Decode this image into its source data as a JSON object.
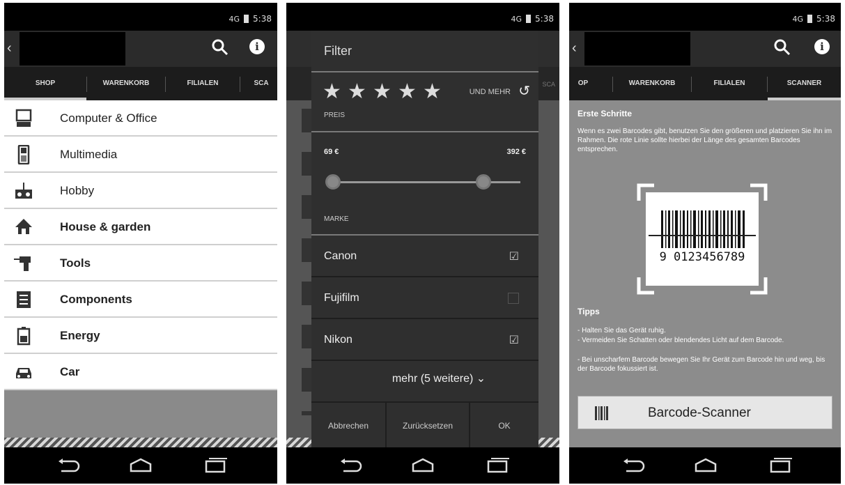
{
  "status": {
    "time": "5:38",
    "signal": "4G"
  },
  "screen1": {
    "tabs": [
      "SHOP",
      "WARENKORB",
      "FILIALEN",
      "SCA"
    ],
    "categories": [
      {
        "label": "Computer & Office",
        "icon": "computer-icon"
      },
      {
        "label": "Multimedia",
        "icon": "phone-icon"
      },
      {
        "label": "Hobby",
        "icon": "remote-control-icon"
      },
      {
        "label": "House & garden",
        "icon": "house-icon"
      },
      {
        "label": "Tools",
        "icon": "drill-icon"
      },
      {
        "label": "Components",
        "icon": "circuit-board-icon"
      },
      {
        "label": "Energy",
        "icon": "battery-icon"
      },
      {
        "label": "Car",
        "icon": "car-icon"
      }
    ]
  },
  "screen2": {
    "background_tab": "SCA",
    "filter": {
      "title": "Filter",
      "rating_label": "UND MEHR",
      "price_label": "PREIS",
      "price_min": "69 €",
      "price_max": "392 €",
      "brand_label": "MARKE",
      "brands": [
        {
          "label": "Canon",
          "checked": true
        },
        {
          "label": "Fujifilm",
          "checked": false
        },
        {
          "label": "Nikon",
          "checked": true
        }
      ],
      "more_label": "mehr (5 weitere)",
      "buttons": {
        "cancel": "Abbrechen",
        "reset": "Zurücksetzen",
        "ok": "OK"
      }
    }
  },
  "screen3": {
    "tabs": [
      "OP",
      "WARENKORB",
      "FILIALEN",
      "SCANNER"
    ],
    "first_steps_title": "Erste Schritte",
    "first_steps_text": "Wenn es zwei Barcodes gibt, benutzen Sie den größeren und platzieren Sie ihn im Rahmen. Die rote Linie sollte hierbei der Länge des gesamten Barcodes entsprechen.",
    "barcode_digits": "9 0123456789",
    "tips_title": "Tipps",
    "tips": [
      "- Halten Sie das Gerät ruhig.",
      "- Vermeiden Sie Schatten oder blendendes Licht auf dem Barcode.",
      "- Bei unscharfem Barcode bewegen Sie Ihr Gerät zum Barcode hin und weg, bis der Barcode fokussiert ist."
    ],
    "scanner_button": "Barcode-Scanner"
  },
  "colors": {
    "appbar": "#2b2b2b",
    "tabbar": "#1c1c1c",
    "dialog": "#2f2f2f",
    "content_grey": "#8c8c8c"
  }
}
